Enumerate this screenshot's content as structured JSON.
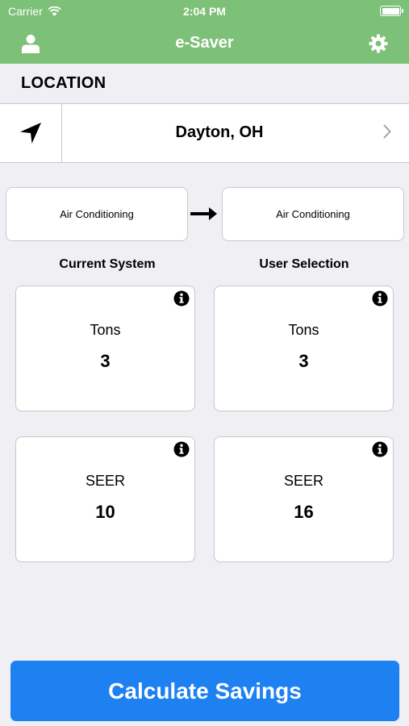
{
  "status_bar": {
    "carrier": "Carrier",
    "time": "2:04 PM"
  },
  "navbar": {
    "title": "e-Saver",
    "left_icon": "user-icon",
    "right_icon": "gear-icon"
  },
  "location": {
    "section_title": "LOCATION",
    "value": "Dayton, OH",
    "icon": "location-arrow-icon"
  },
  "systems": {
    "current": "Air Conditioning",
    "selected": "Air Conditioning"
  },
  "columns": {
    "current_label": "Current System",
    "user_label": "User Selection"
  },
  "cards": {
    "current_tons": {
      "label": "Tons",
      "value": "3"
    },
    "user_tons": {
      "label": "Tons",
      "value": "3"
    },
    "current_seer": {
      "label": "SEER",
      "value": "10"
    },
    "user_seer": {
      "label": "SEER",
      "value": "16"
    }
  },
  "action": {
    "calculate_label": "Calculate Savings"
  },
  "colors": {
    "header": "#7dc077",
    "primary_button": "#1e81f2",
    "background": "#efeff4"
  }
}
